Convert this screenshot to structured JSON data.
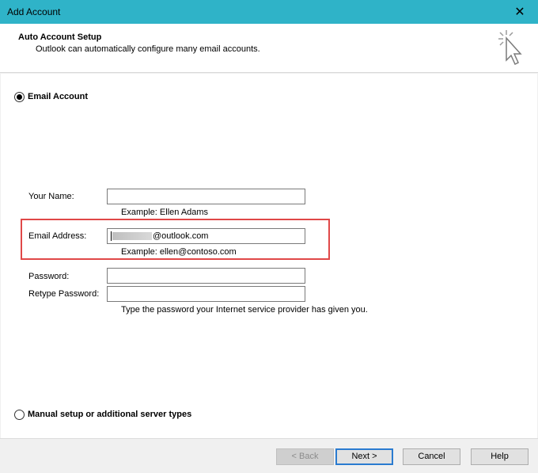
{
  "window": {
    "title": "Add Account",
    "close_glyph": "✕"
  },
  "header": {
    "title": "Auto Account Setup",
    "subtitle": "Outlook can automatically configure many email accounts.",
    "icon": "cursor-click-icon"
  },
  "options": {
    "email_account_label": "Email Account",
    "email_account_selected": true,
    "manual_setup_label": "Manual setup or additional server types",
    "manual_setup_selected": false
  },
  "form": {
    "your_name_label": "Your Name:",
    "your_name_value": "",
    "your_name_hint": "Example: Ellen Adams",
    "email_label": "Email Address:",
    "email_value_suffix": "@outlook.com",
    "email_hint": "Example: ellen@contoso.com",
    "password_label": "Password:",
    "password_value": "",
    "retype_label": "Retype Password:",
    "retype_value": "",
    "password_hint": "Type the password your Internet service provider has given you."
  },
  "buttons": {
    "back": "< Back",
    "next": "Next >",
    "cancel": "Cancel",
    "help": "Help"
  },
  "colors": {
    "titlebar": "#2fb3c8",
    "highlight": "#e04848",
    "default_button_border": "#2a7bd0"
  }
}
